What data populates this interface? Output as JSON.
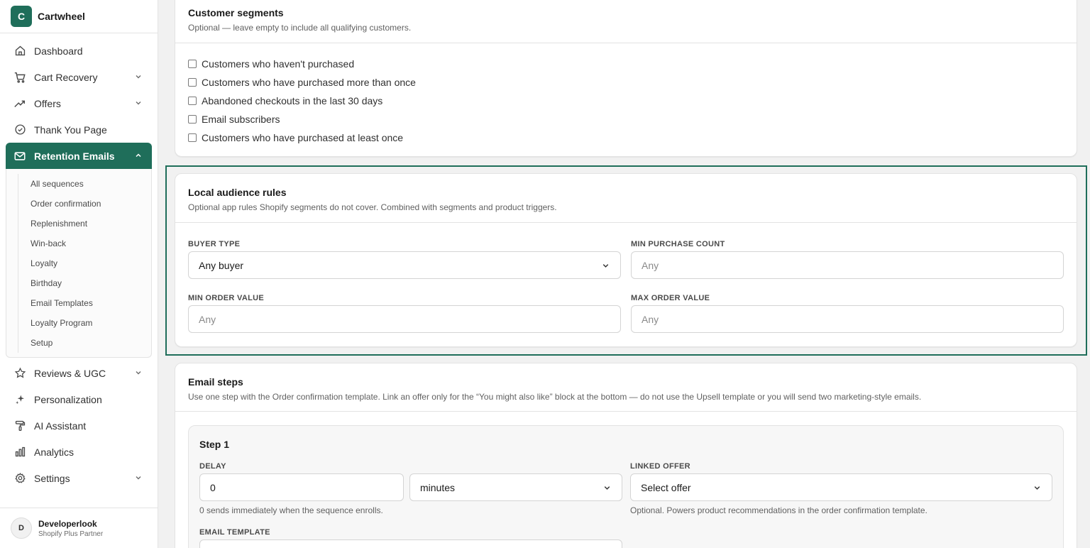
{
  "brand": {
    "logo_letter": "C",
    "name": "Cartwheel",
    "accent": "#1f6e5a"
  },
  "nav": {
    "dashboard": "Dashboard",
    "cart_recovery": "Cart Recovery",
    "offers": "Offers",
    "thank_you": "Thank You Page",
    "retention": "Retention Emails",
    "retention_sub": [
      "All sequences",
      "Order confirmation",
      "Replenishment",
      "Win-back",
      "Loyalty",
      "Birthday",
      "Email Templates",
      "Loyalty Program",
      "Setup"
    ],
    "reviews": "Reviews & UGC",
    "personalization": "Personalization",
    "ai_assistant": "AI Assistant",
    "analytics": "Analytics",
    "settings": "Settings"
  },
  "user": {
    "initial": "D",
    "name": "Developerlook",
    "role": "Shopify Plus Partner"
  },
  "segments": {
    "title": "Customer segments",
    "subtitle": "Optional — leave empty to include all qualifying customers.",
    "options": [
      "Customers who haven't purchased",
      "Customers who have purchased more than once",
      "Abandoned checkouts in the last 30 days",
      "Email subscribers",
      "Customers who have purchased at least once"
    ]
  },
  "audience": {
    "title": "Local audience rules",
    "subtitle": "Optional app rules Shopify segments do not cover. Combined with segments and product triggers.",
    "buyer_type_label": "BUYER TYPE",
    "buyer_type_value": "Any buyer",
    "min_purchase_label": "MIN PURCHASE COUNT",
    "min_purchase_placeholder": "Any",
    "min_order_label": "MIN ORDER VALUE",
    "min_order_placeholder": "Any",
    "max_order_label": "MAX ORDER VALUE",
    "max_order_placeholder": "Any"
  },
  "email_steps": {
    "title": "Email steps",
    "subtitle": "Use one step with the Order confirmation template. Link an offer only for the “You might also like” block at the bottom — do not use the Upsell template or you will send two marketing-style emails.",
    "step_title": "Step 1",
    "delay_label": "DELAY",
    "delay_value": "0",
    "delay_unit": "minutes",
    "delay_help": "0 sends immediately when the sequence enrolls.",
    "linked_offer_label": "LINKED OFFER",
    "linked_offer_value": "Select offer",
    "linked_offer_help": "Optional. Powers product recommendations in the order confirmation template.",
    "template_label": "EMAIL TEMPLATE"
  }
}
